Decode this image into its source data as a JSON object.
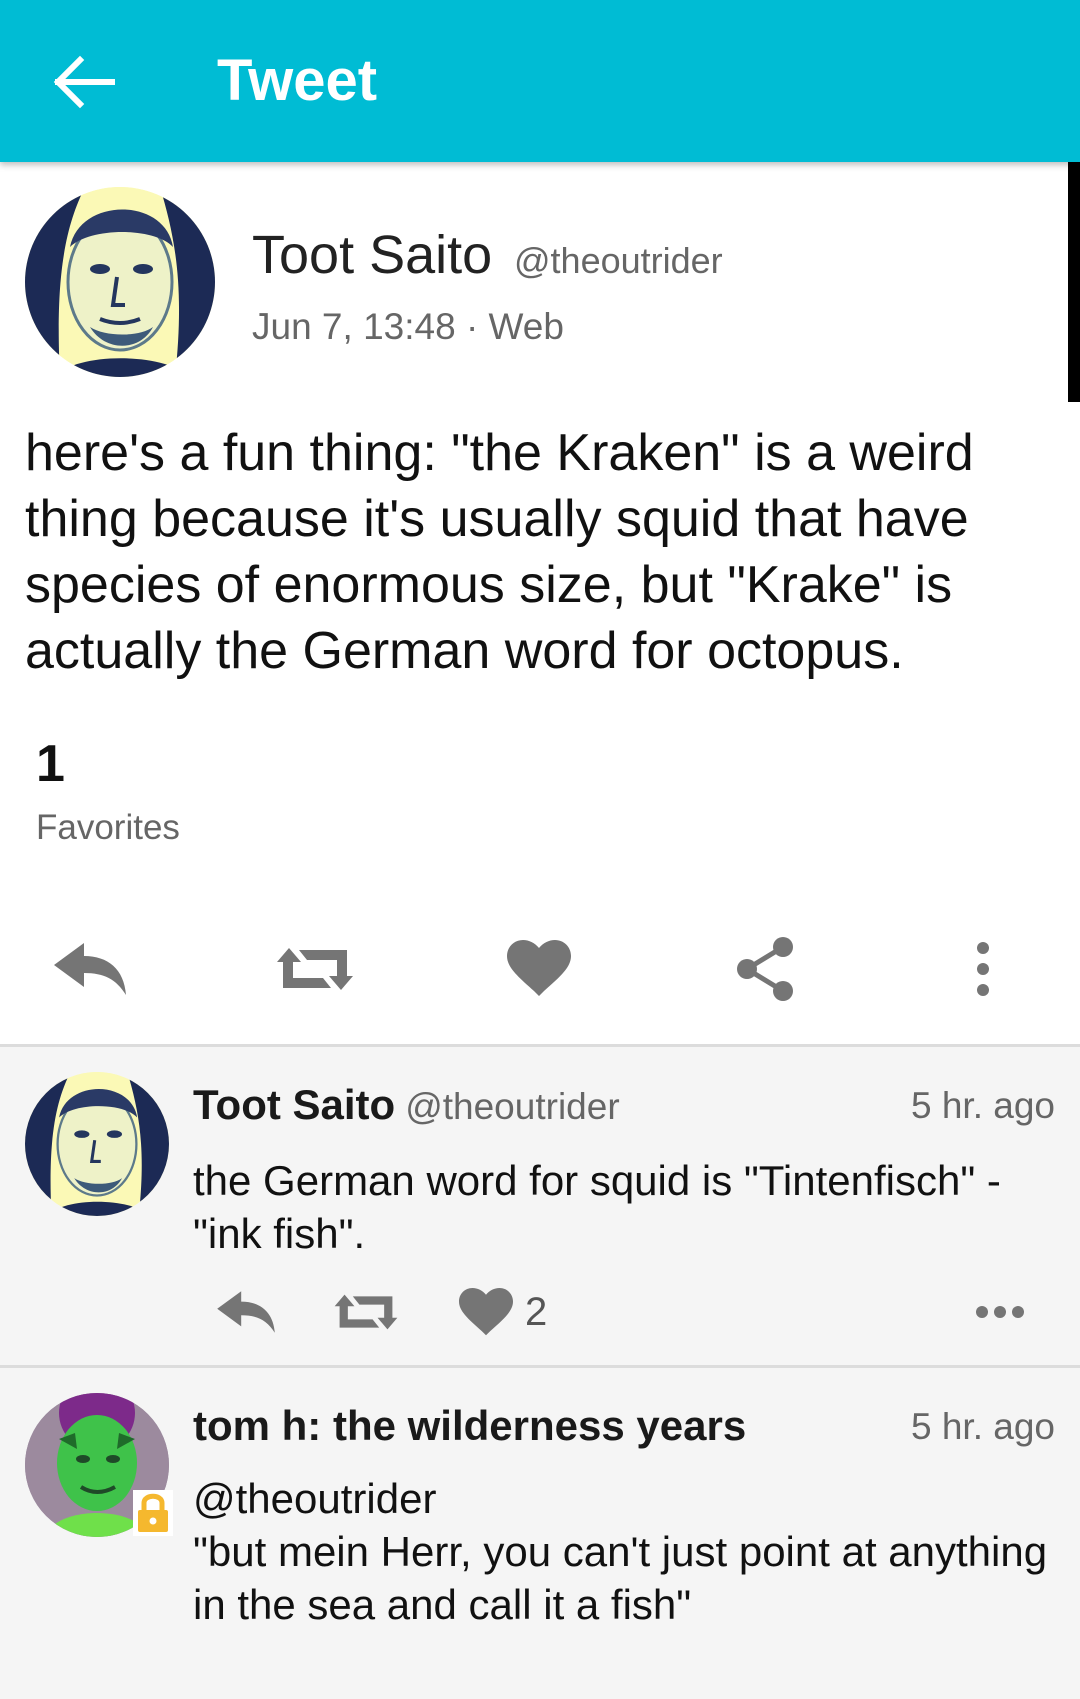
{
  "app_bar": {
    "title": "Tweet",
    "back_icon": "arrow-left-icon"
  },
  "main_tweet": {
    "author_name": "Toot Saito",
    "author_handle": "@theoutrider",
    "meta": "Jun 7, 13:48 · Web",
    "text": "here's a fun thing: \"the Kraken\" is a weird thing because it's usually squid that have species of enormous size, but \"Krake\" is actually the German word for octopus.",
    "favorites_count": "1",
    "favorites_label": "Favorites",
    "actions": [
      "reply-icon",
      "retweet-icon",
      "heart-icon",
      "share-icon",
      "more-vertical-icon"
    ]
  },
  "replies": [
    {
      "author_name": "Toot Saito",
      "author_handle": "@theoutrider",
      "time": "5 hr. ago",
      "text": "the German word for squid is \"Tintenfisch\" - \"ink fish\".",
      "like_count": "2"
    },
    {
      "author_name": "tom h: the wilderness years",
      "time": "5 hr. ago",
      "text": "@theoutrider\n\"but mein Herr, you can't just point at anything in the sea and call it a fish\"",
      "locked": true
    }
  ],
  "colors": {
    "app_bar": "#00bcd4",
    "icon_gray": "#757575",
    "lock": "#f5b82e"
  }
}
